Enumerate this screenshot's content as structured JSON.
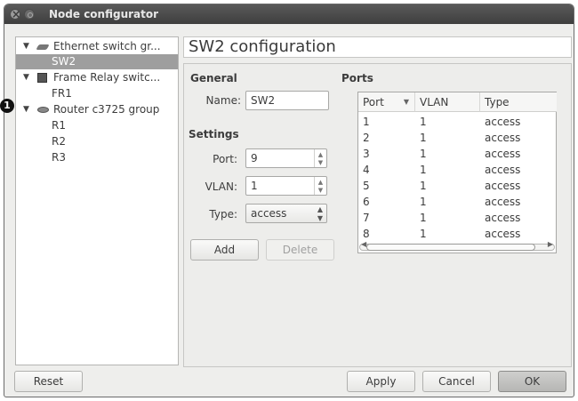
{
  "window": {
    "title": "Node configurator"
  },
  "tree": {
    "groups": [
      {
        "label": "Ethernet switch gr...",
        "icon": "switch-icon",
        "children": [
          "SW2"
        ]
      },
      {
        "label": "Frame Relay switc...",
        "icon": "frame-relay-icon",
        "children": [
          "FR1"
        ]
      },
      {
        "label": "Router c3725 group",
        "icon": "router-icon",
        "children": [
          "R1",
          "R2",
          "R3"
        ]
      }
    ],
    "selected": "SW2",
    "callout": "1"
  },
  "config": {
    "title": "SW2 configuration",
    "general": {
      "heading": "General",
      "name_label": "Name:",
      "name_value": "SW2"
    },
    "settings": {
      "heading": "Settings",
      "port_label": "Port:",
      "port_value": "9",
      "vlan_label": "VLAN:",
      "vlan_value": "1",
      "type_label": "Type:",
      "type_value": "access"
    },
    "add_label": "Add",
    "delete_label": "Delete",
    "ports": {
      "heading": "Ports",
      "columns": [
        "Port",
        "VLAN",
        "Type"
      ],
      "rows": [
        [
          "1",
          "1",
          "access"
        ],
        [
          "2",
          "1",
          "access"
        ],
        [
          "3",
          "1",
          "access"
        ],
        [
          "4",
          "1",
          "access"
        ],
        [
          "5",
          "1",
          "access"
        ],
        [
          "6",
          "1",
          "access"
        ],
        [
          "7",
          "1",
          "access"
        ],
        [
          "8",
          "1",
          "access"
        ]
      ]
    }
  },
  "footer": {
    "reset_label": "Reset",
    "apply_label": "Apply",
    "cancel_label": "Cancel",
    "ok_label": "OK"
  }
}
